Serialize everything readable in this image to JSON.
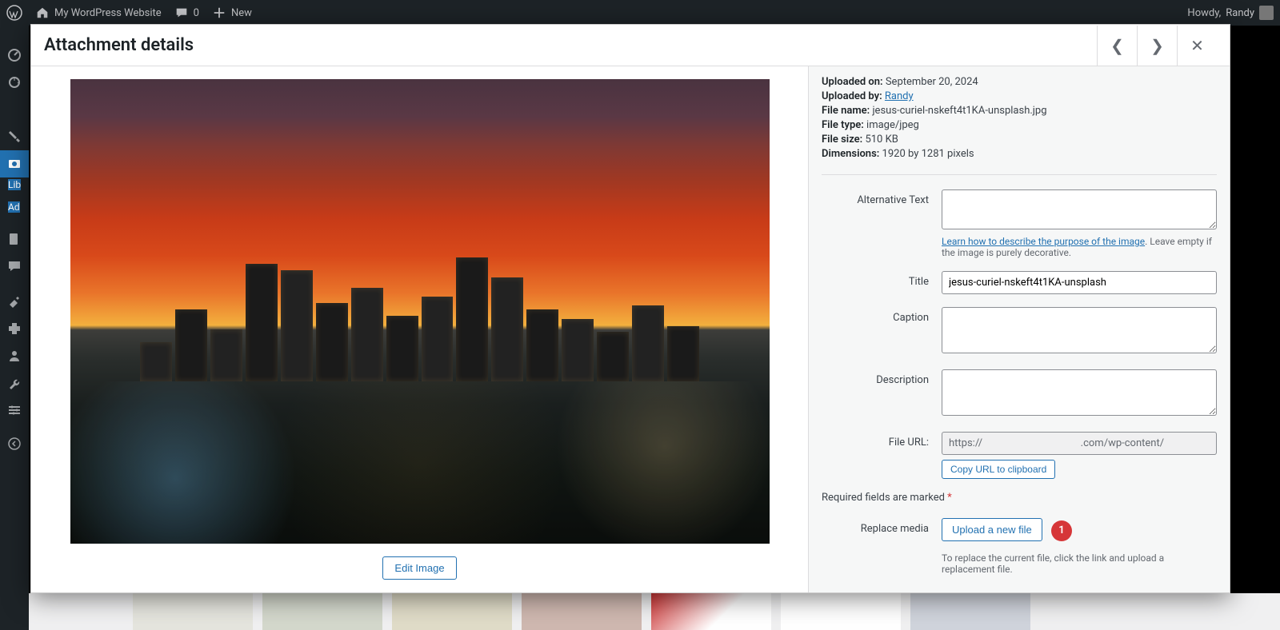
{
  "adminbar": {
    "site_title": "My WordPress Website",
    "comments": "0",
    "new": "New",
    "howdy_prefix": "Howdy, ",
    "user": "Randy"
  },
  "sidebar": {
    "sub_lib": "Lib",
    "sub_ad": "Ad"
  },
  "modal": {
    "title": "Attachment details",
    "edit_image": "Edit Image",
    "details": {
      "uploaded_on_label": "Uploaded on:",
      "uploaded_on_value": "September 20, 2024",
      "uploaded_by_label": "Uploaded by:",
      "uploaded_by_value": "Randy",
      "filename_label": "File name:",
      "filename_value": "jesus-curiel-nskeft4t1KA-unsplash.jpg",
      "filetype_label": "File type:",
      "filetype_value": "image/jpeg",
      "filesize_label": "File size:",
      "filesize_value": "510 KB",
      "dimensions_label": "Dimensions:",
      "dimensions_value": "1920 by 1281 pixels"
    },
    "fields": {
      "alt_label": "Alternative Text",
      "alt_value": "",
      "alt_help_link": "Learn how to describe the purpose of the image",
      "alt_help_tail": ". Leave empty if the image is purely decorative.",
      "title_label": "Title",
      "title_value": "jesus-curiel-nskeft4t1KA-unsplash",
      "caption_label": "Caption",
      "caption_value": "",
      "description_label": "Description",
      "description_value": "",
      "fileurl_label": "File URL:",
      "fileurl_value": "https://                                      .com/wp-content/",
      "copy_btn": "Copy URL to clipboard"
    },
    "required_text": "Required fields are marked ",
    "required_star": "*",
    "replace": {
      "label": "Replace media",
      "button": "Upload a new file",
      "help": "To replace the current file, click the link and upload a replacement file."
    },
    "annotation": "1"
  }
}
